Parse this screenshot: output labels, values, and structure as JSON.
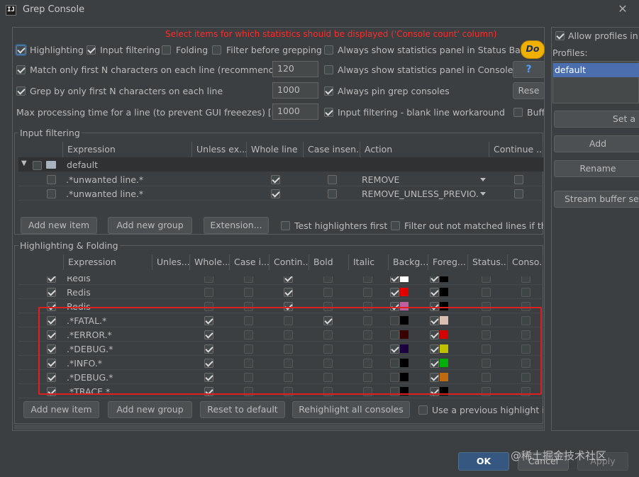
{
  "window": {
    "title": "Grep Console",
    "app_icon": "IJ",
    "close_glyph": "✕"
  },
  "warning": "Select items for which statistics should be displayed ('Console count' column)",
  "options": {
    "highlighting": "Highlighting",
    "input_filtering": "Input filtering",
    "folding": "Folding",
    "filter_before": "Filter before grepping",
    "always_stats_status": "Always show statistics panel in Status Bar",
    "match_first_n": "Match only first N characters on each line (recommended)",
    "match_first_n_value": "120",
    "always_stats_console": "Always show statistics panel in Console",
    "grep_first_n": "Grep by only first N characters on each line",
    "grep_first_n_value": "1000",
    "always_pin": "Always pin grep consoles",
    "max_processing": "Max processing time for a line (to prevent GUI freeezes) [ms]",
    "max_processing_value": "1000",
    "blank_line": "Input filtering - blank line workaround",
    "donate": "Do",
    "help": "?",
    "reset": "Rese",
    "buffer": "Buff"
  },
  "input_filtering": {
    "title": "Input filtering",
    "columns": [
      "Expression",
      "Unless ex...",
      "Whole line",
      "Case insen...",
      "Action",
      "Continue ..."
    ],
    "group": "default",
    "rows": [
      {
        "expr": ".*unwanted line.*",
        "whole": true,
        "case": false,
        "action": "REMOVE",
        "cont": false
      },
      {
        "expr": ".*unwanted line.*",
        "whole": true,
        "case": false,
        "action": "REMOVE_UNLESS_PREVIO...",
        "cont": false
      }
    ],
    "buttons": {
      "add_item": "Add new item",
      "add_group": "Add new group",
      "extension": "Extension..."
    },
    "test_first": "Test highlighters first",
    "filter_out": "Filter out not matched lines if the"
  },
  "highlighting": {
    "title": "Highlighting & Folding",
    "columns": [
      "Expression",
      "Unles...",
      "Whole...",
      "Case i...",
      "Contin...",
      "Bold",
      "Italic",
      "Backg...",
      "Foreg...",
      "Status...",
      "Conso..."
    ],
    "rows": [
      {
        "expr": "Redis",
        "whole": false,
        "cont": true,
        "bold": false,
        "bg_on": true,
        "bg": "#ffffff",
        "fg_on": true,
        "fg": "#000000"
      },
      {
        "expr": "Redis",
        "whole": false,
        "cont": true,
        "bold": false,
        "bg_on": true,
        "bg": "#e00000",
        "fg_on": true,
        "fg": "#000000"
      },
      {
        "expr": "Redis",
        "whole": false,
        "cont": true,
        "bold": false,
        "bg_on": true,
        "bg": "#c060a0",
        "fg_on": true,
        "fg": "#000000"
      },
      {
        "expr": ".*FATAL.*",
        "whole": true,
        "cont": false,
        "bold": true,
        "bg_on": false,
        "bg": "#000000",
        "fg_on": true,
        "fg": "#d9bfb0"
      },
      {
        "expr": ".*ERROR.*",
        "whole": true,
        "cont": false,
        "bold": false,
        "bg_on": false,
        "bg": "#3a0000",
        "fg_on": true,
        "fg": "#d40000"
      },
      {
        "expr": ".*DEBUG.*",
        "whole": true,
        "cont": false,
        "bold": false,
        "bg_on": true,
        "bg": "#1a0040",
        "fg_on": true,
        "fg": "#c0c000"
      },
      {
        "expr": ".*INFO.*",
        "whole": true,
        "cont": false,
        "bold": false,
        "bg_on": false,
        "bg": "#000000",
        "fg_on": true,
        "fg": "#00b000"
      },
      {
        "expr": ".*DEBUG.*",
        "whole": true,
        "cont": false,
        "bold": false,
        "bg_on": false,
        "bg": "#000000",
        "fg_on": true,
        "fg": "#c06a10"
      },
      {
        "expr": ".*TRACE.*",
        "whole": true,
        "cont": false,
        "bold": false,
        "bg_on": false,
        "bg": "#000000",
        "fg_on": true,
        "fg": "#000000"
      }
    ],
    "buttons": {
      "add_item": "Add new item",
      "add_group": "Add new group",
      "reset": "Reset to default",
      "rehighlight": "Rehighlight all consoles"
    },
    "use_previous": "Use a previous highlight if a"
  },
  "profiles": {
    "allow": "Allow profiles in P",
    "label": "Profiles:",
    "items": [
      "default"
    ],
    "set": "Set a",
    "add": "Add",
    "rename": "Rename",
    "stream": "Stream buffer sett"
  },
  "footer": {
    "ok": "OK",
    "cancel": "Cancel",
    "apply": "Apply"
  },
  "watermark": "@稀土掘金技术社区",
  "colors": {
    "accent": "#365880",
    "warning": "#ff2a2a",
    "highlight_box": "#e02020",
    "selection": "#4b6eaf"
  }
}
